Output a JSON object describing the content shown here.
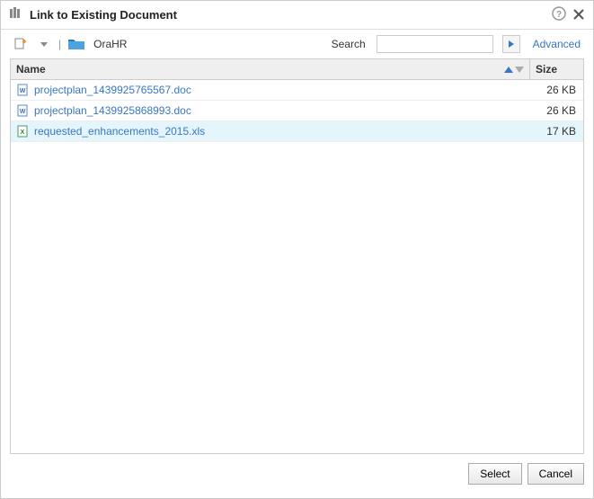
{
  "dialog": {
    "title": "Link to Existing Document"
  },
  "toolbar": {
    "breadcrumb": "OraHR",
    "search_label": "Search",
    "search_placeholder": "",
    "advanced_label": "Advanced"
  },
  "table": {
    "columns": {
      "name": "Name",
      "size": "Size"
    },
    "rows": [
      {
        "name": "projectplan_1439925765567.doc",
        "size": "26 KB",
        "type": "doc",
        "selected": false
      },
      {
        "name": "projectplan_1439925868993.doc",
        "size": "26 KB",
        "type": "doc",
        "selected": false
      },
      {
        "name": "requested_enhancements_2015.xls",
        "size": "17 KB",
        "type": "xls",
        "selected": true
      }
    ]
  },
  "footer": {
    "select_label": "Select",
    "cancel_label": "Cancel"
  }
}
